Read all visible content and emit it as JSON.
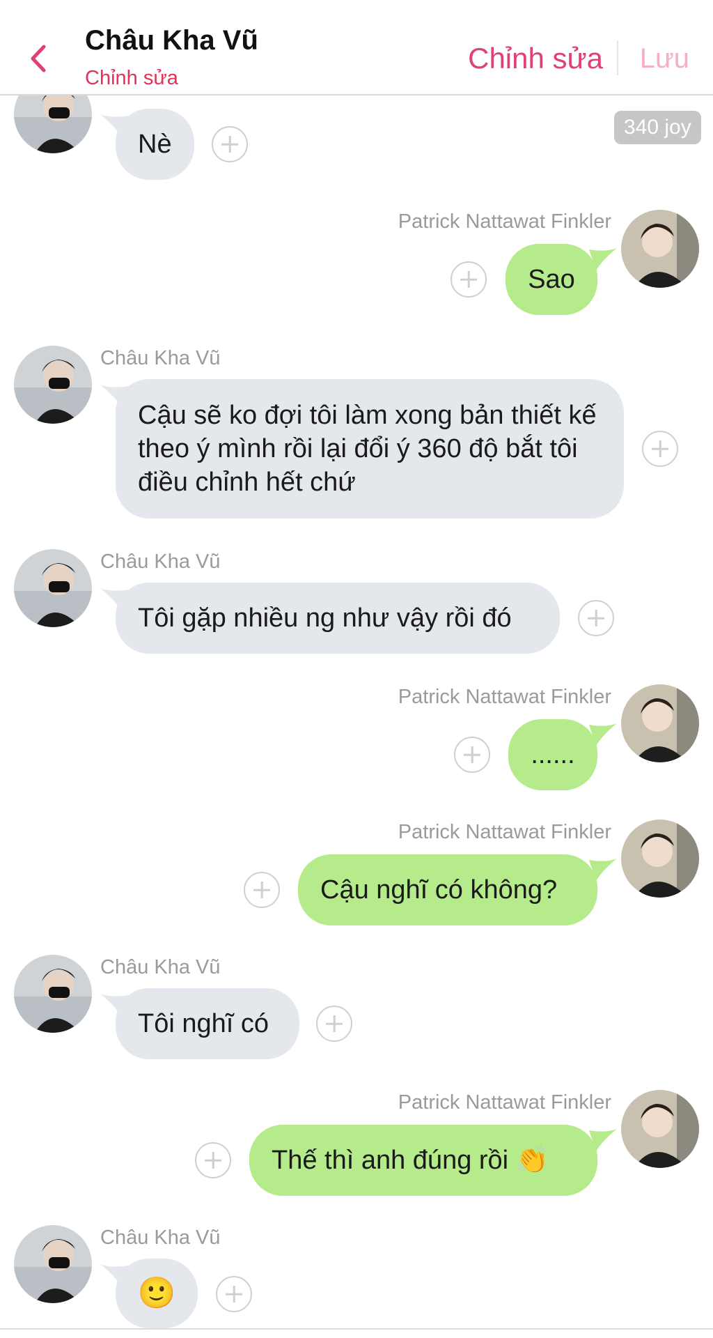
{
  "header": {
    "title": "Châu Kha Vũ",
    "subtitle": "Chỉnh sửa",
    "edit_label": "Chỉnh sửa",
    "save_label": "Lưu"
  },
  "joy_badge": "340 joy",
  "messages": [
    {
      "side": "left",
      "sender": "",
      "text": "Nè"
    },
    {
      "side": "right",
      "sender": "Patrick Nattawat Finkler",
      "text": "Sao"
    },
    {
      "side": "left",
      "sender": "Châu Kha Vũ",
      "text": "Cậu sẽ ko đợi tôi làm xong bản thiết kế theo ý mình rồi lại đổi ý 360 độ bắt tôi điều chỉnh hết chứ"
    },
    {
      "side": "left",
      "sender": "Châu Kha Vũ",
      "text": "Tôi gặp nhiều ng như vậy rồi đó"
    },
    {
      "side": "right",
      "sender": "Patrick Nattawat Finkler",
      "text": "......"
    },
    {
      "side": "right",
      "sender": "Patrick Nattawat Finkler",
      "text": "Cậu nghĩ có không?"
    },
    {
      "side": "left",
      "sender": "Châu Kha Vũ",
      "text": "Tôi nghĩ có"
    },
    {
      "side": "right",
      "sender": "Patrick Nattawat Finkler",
      "text": "Thế thì anh đúng rồi 👏"
    },
    {
      "side": "left",
      "sender": "Châu Kha Vũ",
      "text": "🙂"
    }
  ],
  "colors": {
    "accent": "#e0407a",
    "left_bubble": "#e4e8ec",
    "right_bubble": "#b5eb8a",
    "sender_text": "#9a9a9a"
  }
}
